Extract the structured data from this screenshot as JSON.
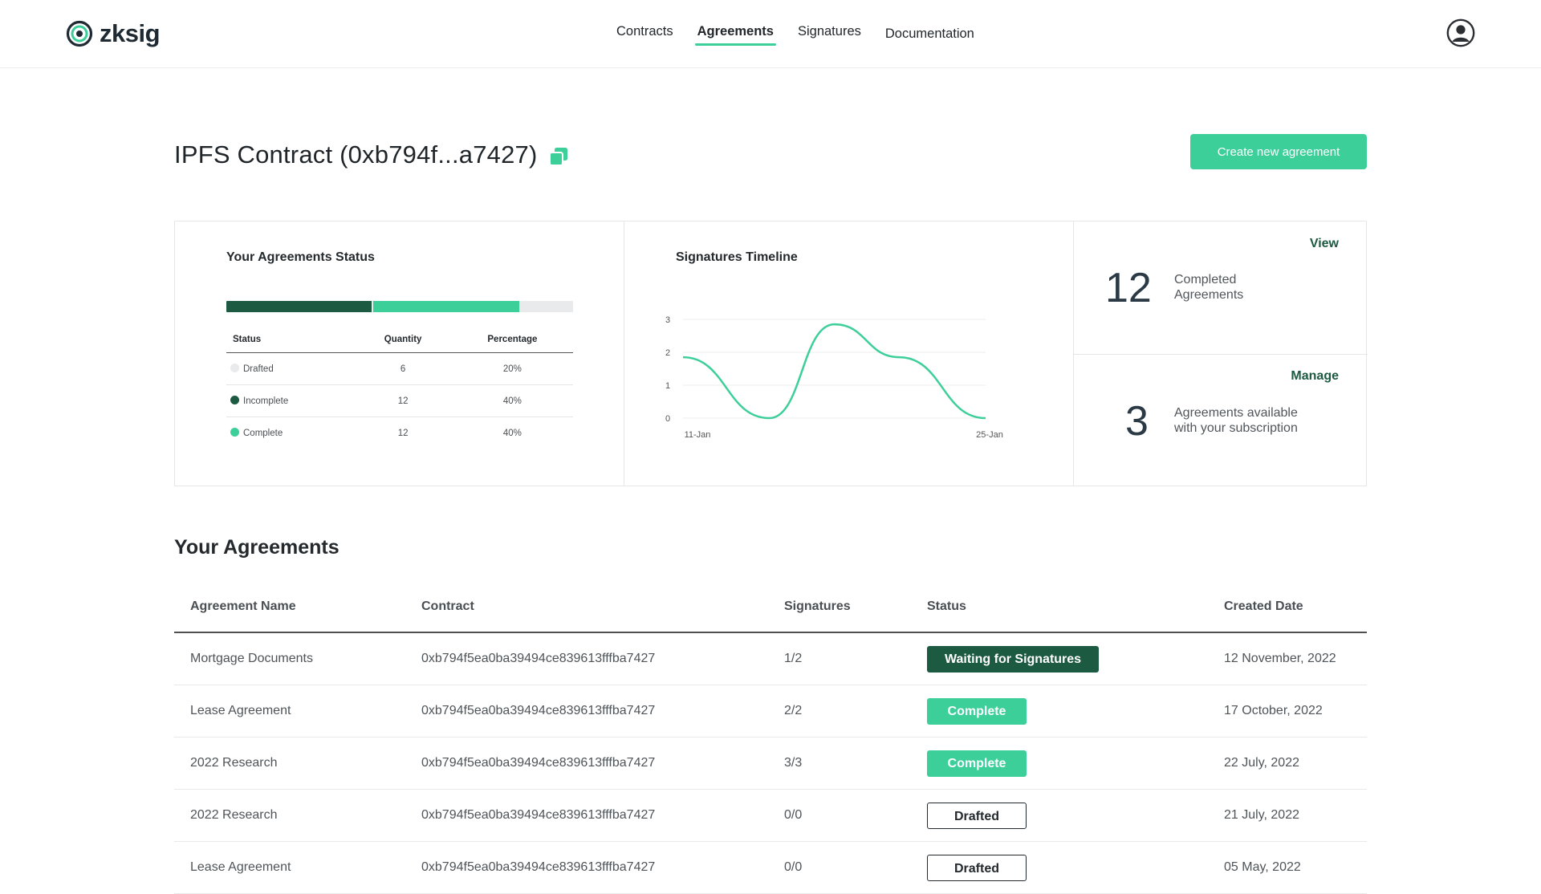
{
  "brand": {
    "name": "zksig"
  },
  "nav": [
    {
      "label": "Contracts",
      "active": false
    },
    {
      "label": "Agreements",
      "active": true
    },
    {
      "label": "Signatures",
      "active": false
    },
    {
      "label": "Documentation",
      "active": false
    }
  ],
  "user": {
    "icon": "user-circle-icon"
  },
  "page": {
    "title": "IPFS Contract (0xb794f...a7427)",
    "copy_icon": "copy-icon",
    "create_button": "Create new agreement"
  },
  "status_panel": {
    "title": "Your Agreements Status",
    "progress": {
      "incomplete": 0.42,
      "complete": 0.42,
      "drafted": 0.16
    },
    "headers": {
      "status": "Status",
      "quantity": "Quantity",
      "percentage": "Percentage"
    },
    "rows": [
      {
        "status": "Drafted",
        "quantity": "6",
        "percentage": "20%",
        "color": "#e9eaeb"
      },
      {
        "status": "Incomplete",
        "quantity": "12",
        "percentage": "40%",
        "color": "#1c5a41"
      },
      {
        "status": "Complete",
        "quantity": "12",
        "percentage": "40%",
        "color": "#3dcf9a"
      }
    ]
  },
  "timeline_panel": {
    "title": "Signatures Timeline"
  },
  "chart_data": {
    "type": "line",
    "title": "Signatures Timeline",
    "xlabel": "",
    "ylabel": "",
    "x_ticks": [
      "11-Jan",
      "25-Jan"
    ],
    "y_ticks": [
      0,
      1,
      2,
      3
    ],
    "ylim": [
      0,
      3
    ],
    "grid": true,
    "line_color": "#3dcf9a",
    "series": [
      {
        "x": [
          0,
          4,
          7,
          10,
          14
        ],
        "values": [
          1.85,
          0.0,
          2.85,
          1.85,
          0.0
        ]
      }
    ]
  },
  "summary": {
    "completed": {
      "link": "View",
      "number": "12",
      "text": "Completed Agreements"
    },
    "available": {
      "link": "Manage",
      "number": "3",
      "text": "Agreements available with your subscription"
    }
  },
  "agreements": {
    "title": "Your Agreements",
    "headers": {
      "name": "Agreement Name",
      "contract": "Contract",
      "signatures": "Signatures",
      "status": "Status",
      "created": "Created Date"
    },
    "rows": [
      {
        "name": "Mortgage Documents",
        "contract": "0xb794f5ea0ba39494ce839613fffba7427",
        "signatures": "1/2",
        "status": "Waiting for Signatures",
        "status_type": "waiting",
        "created": "12 November, 2022"
      },
      {
        "name": "Lease Agreement",
        "contract": "0xb794f5ea0ba39494ce839613fffba7427",
        "signatures": "2/2",
        "status": "Complete",
        "status_type": "complete",
        "created": "17 October, 2022"
      },
      {
        "name": "2022 Research",
        "contract": "0xb794f5ea0ba39494ce839613fffba7427",
        "signatures": "3/3",
        "status": "Complete",
        "status_type": "complete",
        "created": "22 July, 2022"
      },
      {
        "name": "2022 Research",
        "contract": "0xb794f5ea0ba39494ce839613fffba7427",
        "signatures": "0/0",
        "status": "Drafted",
        "status_type": "drafted",
        "created": "21 July, 2022"
      },
      {
        "name": "Lease Agreement",
        "contract": "0xb794f5ea0ba39494ce839613fffba7427",
        "signatures": "0/0",
        "status": "Drafted",
        "status_type": "drafted",
        "created": "05 May, 2022"
      }
    ]
  }
}
